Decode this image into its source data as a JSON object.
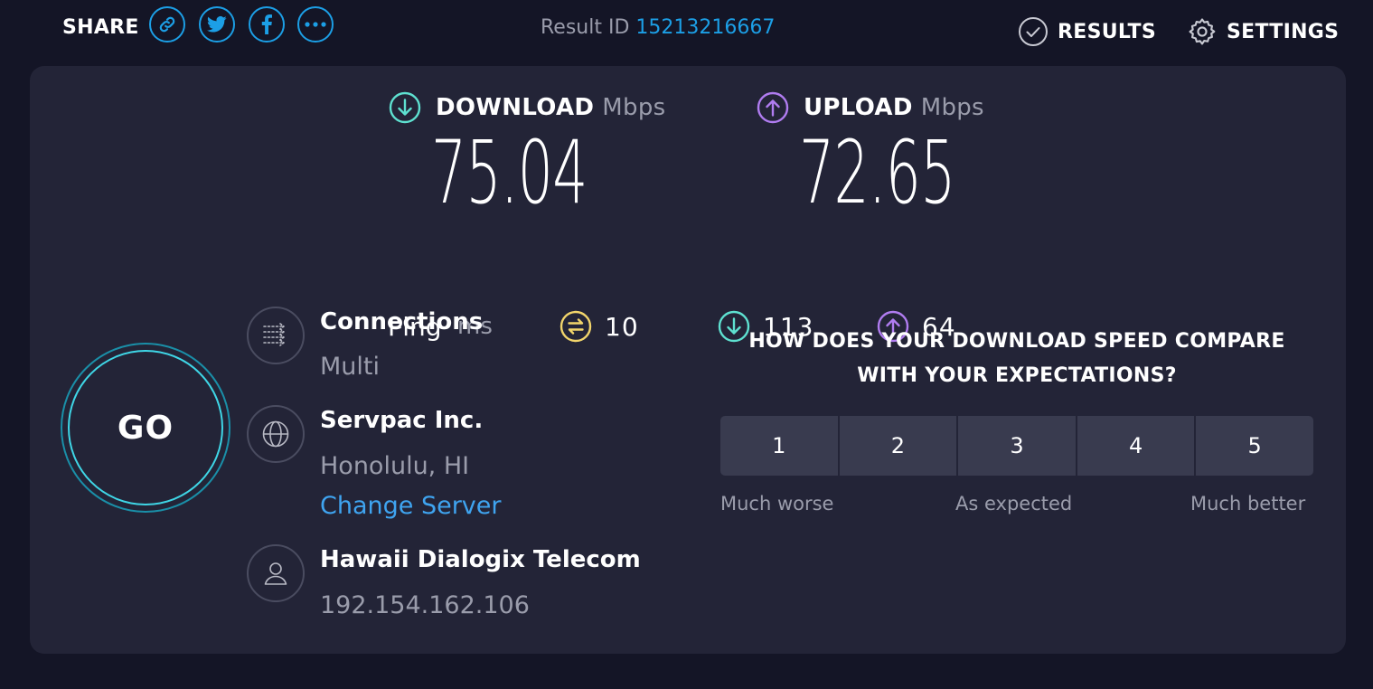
{
  "header": {
    "share_label": "SHARE",
    "share_buttons": [
      "link-icon",
      "twitter-icon",
      "facebook-icon",
      "more-icon"
    ],
    "result_id_label": "Result ID",
    "result_id_value": "15213216667",
    "results_label": "RESULTS",
    "settings_label": "SETTINGS"
  },
  "download": {
    "label": "DOWNLOAD",
    "unit": "Mbps",
    "value": "75.04"
  },
  "upload": {
    "label": "UPLOAD",
    "unit": "Mbps",
    "value": "72.65"
  },
  "ping": {
    "label": "Ping",
    "unit": "ms",
    "idle": "10",
    "download": "113",
    "upload": "64"
  },
  "go_label": "GO",
  "connections": {
    "title": "Connections",
    "value": "Multi"
  },
  "server": {
    "name": "Servpac Inc.",
    "location": "Honolulu, HI",
    "change_label": "Change Server"
  },
  "provider": {
    "name": "Hawaii Dialogix Telecom",
    "ip": "192.154.162.106"
  },
  "survey": {
    "question_line1": "HOW DOES YOUR DOWNLOAD SPEED COMPARE",
    "question_line2": "WITH YOUR EXPECTATIONS?",
    "options": [
      "1",
      "2",
      "3",
      "4",
      "5"
    ],
    "low_label": "Much worse",
    "mid_label": "As expected",
    "high_label": "Much better"
  },
  "colors": {
    "background": "#141526",
    "panel": "#232437",
    "accent_blue": "#1c9fe6",
    "download": "#5ee0d0",
    "upload": "#b07cf0",
    "ping": "#f2d56b"
  }
}
